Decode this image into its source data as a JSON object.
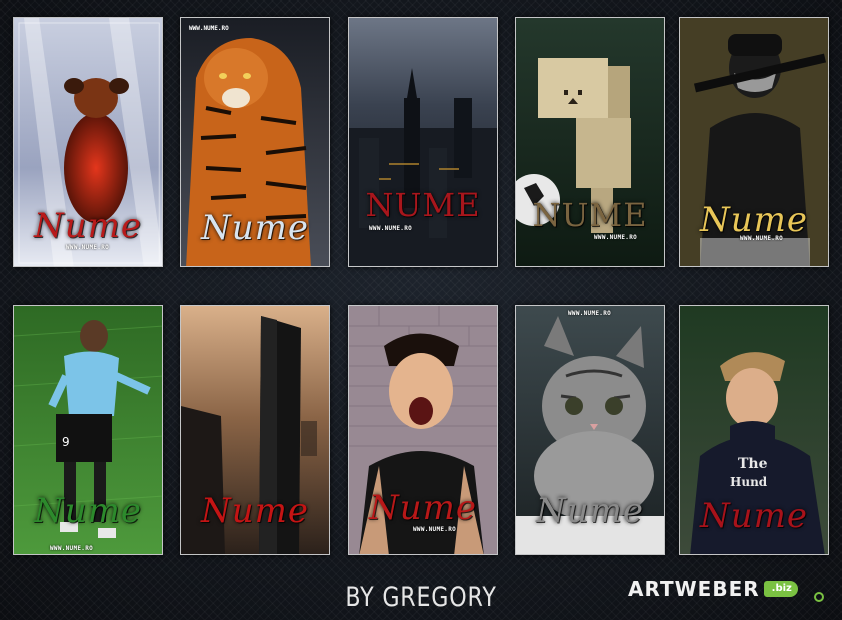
{
  "cards": [
    {
      "id": "dog",
      "name": "Nume",
      "name_color": "#b81a1a",
      "url": "WWW.NUME.RO"
    },
    {
      "id": "tiger",
      "name": "Nume",
      "name_color": "#d8e4f0",
      "url": "WWW.NUME.RO"
    },
    {
      "id": "city",
      "name": "NUME",
      "name_color": "#a8161c",
      "url": "WWW.NUME.RO"
    },
    {
      "id": "box-robot",
      "name": "NUME",
      "name_color": "#7a6440",
      "url": "WWW.NUME.RO"
    },
    {
      "id": "masked-man",
      "name": "Nume",
      "name_color": "#e8c658",
      "url": "WWW.NUME.RO"
    },
    {
      "id": "footballer",
      "name": "Nume",
      "name_color": "#2c8a2c",
      "url": "WWW.NUME.RO"
    },
    {
      "id": "tower",
      "name": "Nume",
      "name_color": "#c41414",
      "url": ""
    },
    {
      "id": "boy-screaming",
      "name": "Nume",
      "name_color": "#b81818",
      "url": "WWW.NUME.RO"
    },
    {
      "id": "kitten",
      "name": "Nume",
      "name_color": "#8a8a8a",
      "url": "WWW.NUME.RO"
    },
    {
      "id": "boy-hoodie",
      "name": "Nume",
      "name_color": "#a8121a",
      "url": ""
    }
  ],
  "footer": {
    "title": "BY GREGORY",
    "brand_word": "ARTWEBER",
    "brand_tld": ".biz",
    "brand_color": "#7ac142"
  }
}
